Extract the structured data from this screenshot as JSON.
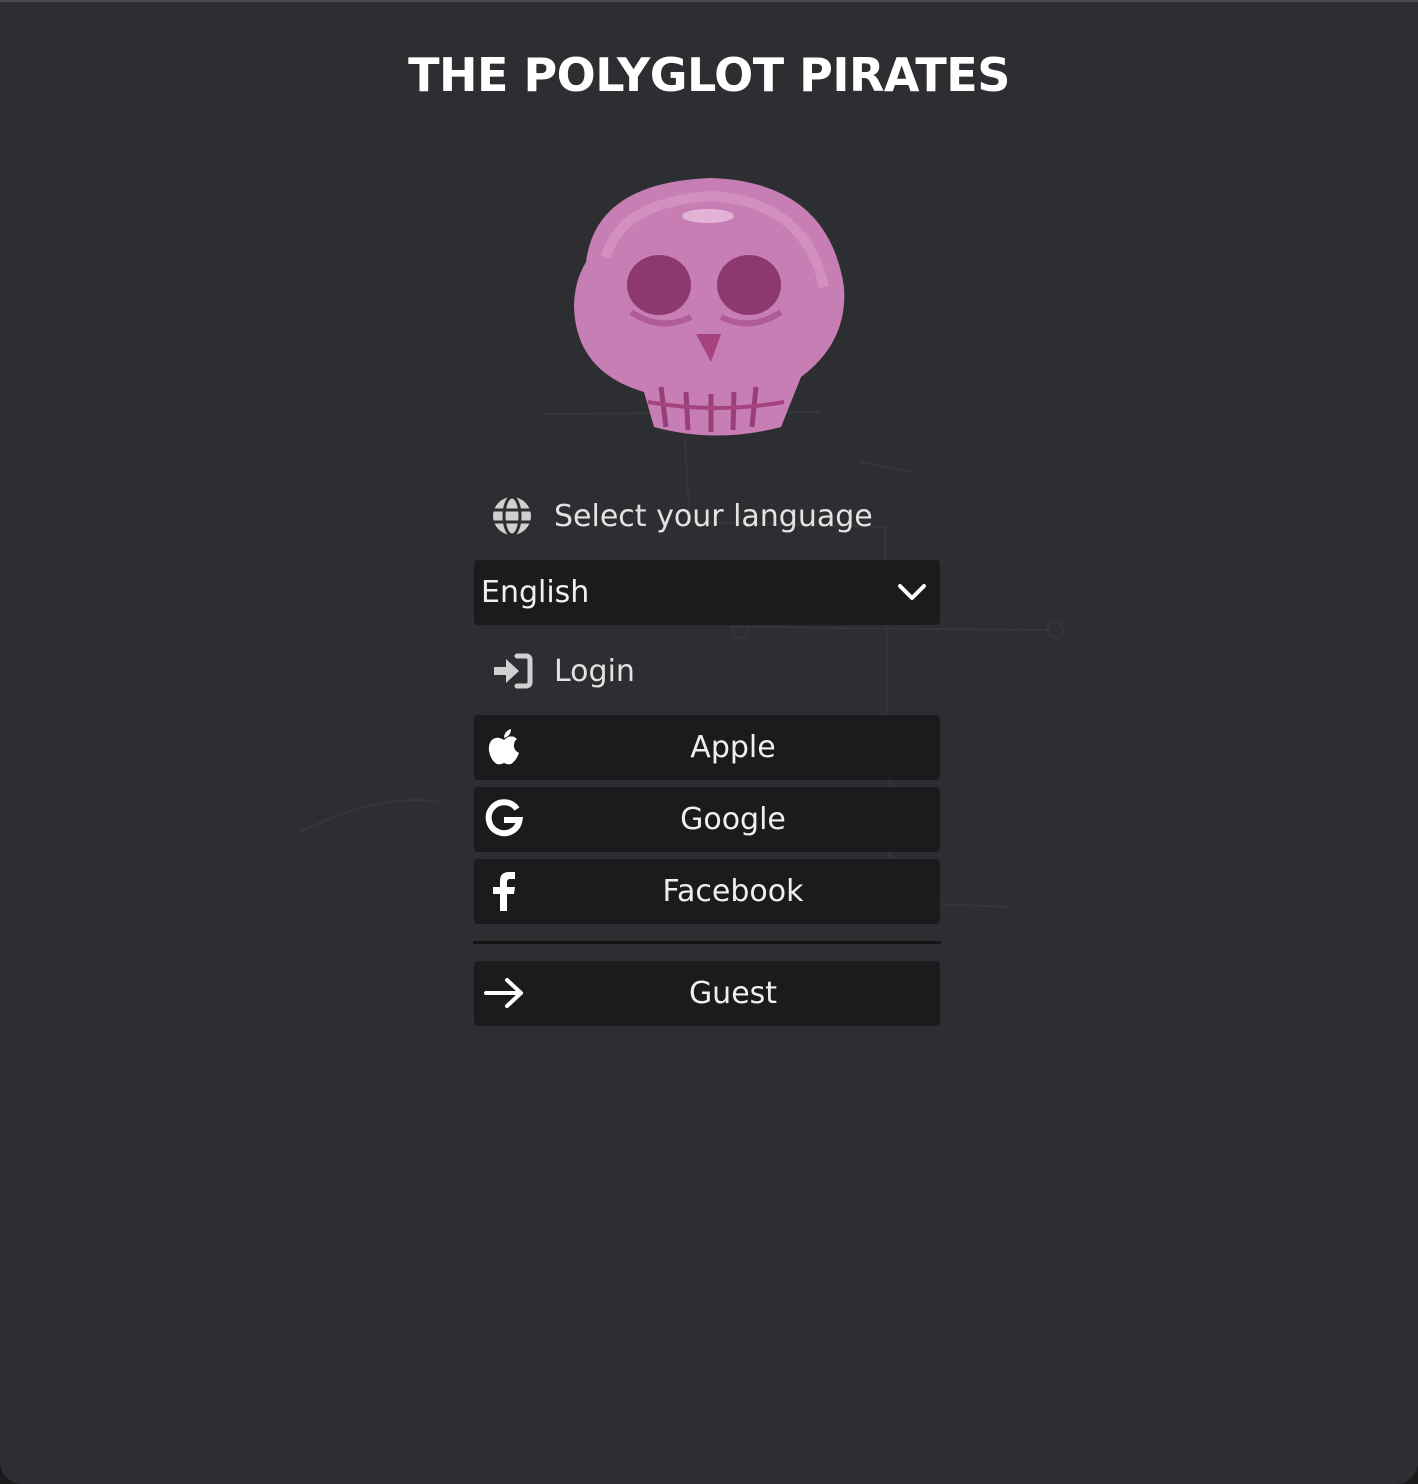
{
  "app": {
    "title": "THE POLYGLOT PIRATES"
  },
  "logo": {
    "icon": "skull-icon",
    "color": "#c77eb5"
  },
  "language": {
    "label": "Select your language",
    "icon": "globe-icon",
    "selected": "English"
  },
  "login": {
    "label": "Login",
    "icon": "sign-in-icon",
    "buttons": [
      {
        "label": "Apple",
        "icon": "apple-icon"
      },
      {
        "label": "Google",
        "icon": "google-icon"
      },
      {
        "label": "Facebook",
        "icon": "facebook-icon"
      }
    ]
  },
  "guest": {
    "label": "Guest",
    "icon": "arrow-right-icon"
  },
  "colors": {
    "background": "#2d2e31",
    "button": "#1b1b1d",
    "text": "#e6e6e6"
  }
}
